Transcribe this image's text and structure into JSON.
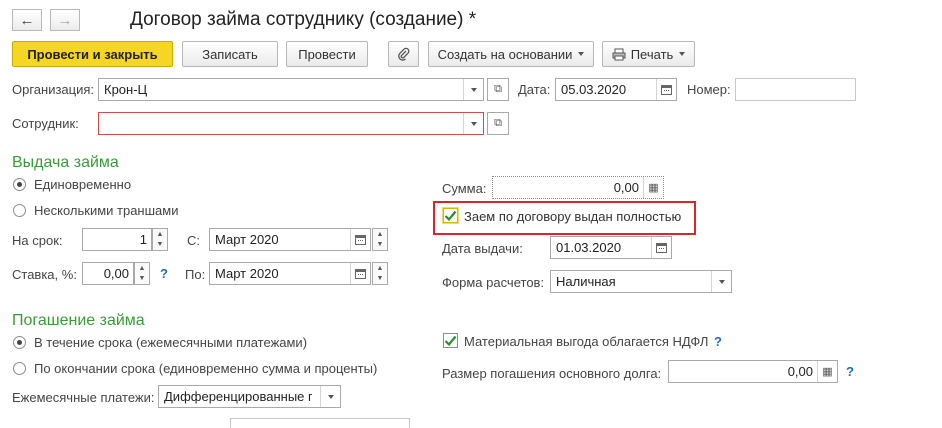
{
  "window": {
    "title": "Договор займа сотруднику (создание) *",
    "back_symbol": "←",
    "forward_symbol": "→"
  },
  "toolbar": {
    "post_close": "Провести и закрыть",
    "save": "Записать",
    "post": "Провести",
    "create_based": "Создать на основании",
    "print": "Печать"
  },
  "header": {
    "org_label": "Организация:",
    "org_value": "Крон-Ц",
    "date_label": "Дата:",
    "date_value": "05.03.2020",
    "number_label": "Номер:",
    "number_value": "",
    "employee_label": "Сотрудник:",
    "employee_value": ""
  },
  "issue": {
    "section_title": "Выдача займа",
    "radio_once": "Единовременно",
    "radio_tranches": "Несколькими траншами",
    "radio_selected": "once",
    "term_label": "На срок:",
    "term_value": "1",
    "from_label": "С:",
    "from_value": "Март 2020",
    "rate_label": "Ставка, %:",
    "rate_value": "0,00",
    "to_label": "По:",
    "to_value": "Март 2020",
    "help": "?"
  },
  "sum": {
    "label": "Сумма:",
    "value": "0,00",
    "issued_fully_label": "Заем по договору выдан полностью",
    "issued_fully_checked": true,
    "issue_date_label": "Дата выдачи:",
    "issue_date_value": "01.03.2020",
    "payment_form_label": "Форма расчетов:",
    "payment_form_value": "Наличная"
  },
  "repayment": {
    "section_title": "Погашение займа",
    "radio_monthly": "В течение срока (ежемесячными платежами)",
    "radio_end": "По окончании срока (единовременно сумма и проценты)",
    "radio_selected": "monthly",
    "monthly_label": "Ежемесячные платежи:",
    "monthly_value": "Дифференцированные платежи",
    "ndfl_label": "Материальная выгода облагается НДФЛ",
    "ndfl_checked": true,
    "principal_label": "Размер погашения основного долга:",
    "principal_value": "0,00",
    "help": "?"
  },
  "colors": {
    "accent_yellow": "#f5d624",
    "section_green": "#3a9a3a",
    "highlight_red": "#d9262b",
    "help_blue": "#1e6fc0"
  }
}
